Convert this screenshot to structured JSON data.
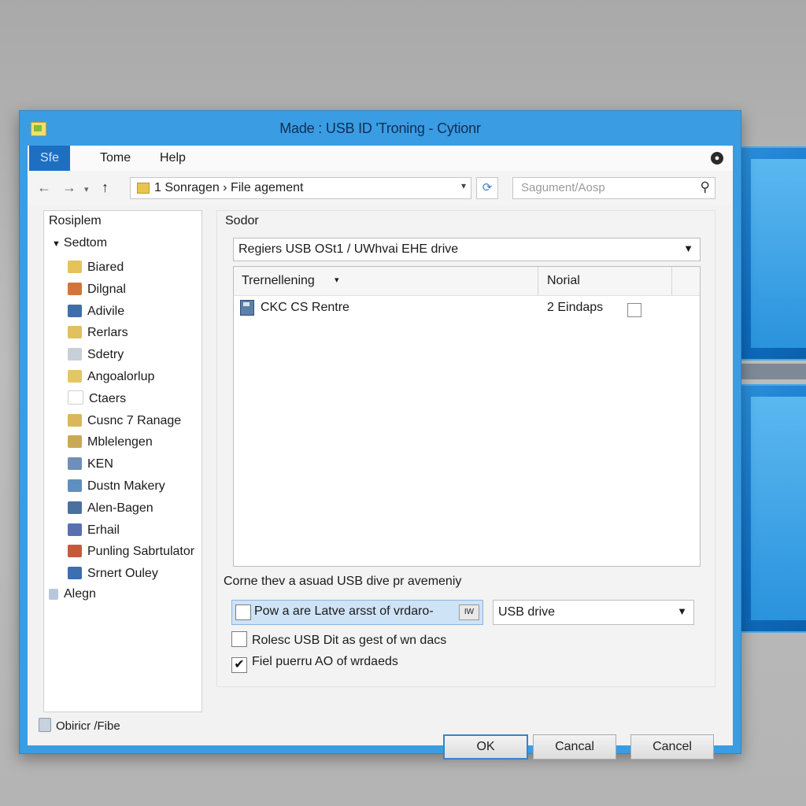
{
  "window": {
    "title": "Made : USB ID 'Troning - Cytionr"
  },
  "menu": {
    "items": [
      {
        "label": "Sfe"
      },
      {
        "label": "Tome"
      },
      {
        "label": "Help"
      }
    ]
  },
  "navigation": {
    "back_icon": "back-arrow-icon",
    "forward_icon": "forward-arrow-icon",
    "up_icon": "up-arrow-icon",
    "address_path": "1  Sonragen  ›  File agement",
    "search_placeholder": "Sagument/Aosp"
  },
  "tree": {
    "root_label": "Rosiplem",
    "section_label": "Sedtom",
    "items": [
      {
        "label": "Biared",
        "icon": "folder-icon",
        "color": "#e6c25a"
      },
      {
        "label": "Dilgnal",
        "icon": "globe-icon",
        "color": "#d4743a"
      },
      {
        "label": "Adivile",
        "icon": "drive-icon",
        "color": "#3f6ea8"
      },
      {
        "label": "Rerlars",
        "icon": "folder-icon",
        "color": "#e0c060"
      },
      {
        "label": "Sdetry",
        "icon": "document-icon",
        "color": "#c7cfd9"
      },
      {
        "label": "Angoalorlup",
        "icon": "folder-icon",
        "color": "#e3c765"
      },
      {
        "label": "Ctaers",
        "icon": "blank-icon",
        "color": "#ffffff"
      },
      {
        "label": "Cusnc 7 Ranage",
        "icon": "folder-icon",
        "color": "#d9b75a"
      },
      {
        "label": "Mblelengen",
        "icon": "folder-icon",
        "color": "#c9a955"
      },
      {
        "label": "KEN",
        "icon": "x-icon",
        "color": "#6f8fb8"
      },
      {
        "label": "Dustn Makery",
        "icon": "network-icon",
        "color": "#5f8fc0"
      },
      {
        "label": "Alen-Bagen",
        "icon": "monitor-icon",
        "color": "#4b6f9f"
      },
      {
        "label": "Erhail",
        "icon": "image-icon",
        "color": "#5a6fb2"
      },
      {
        "label": "Punling Sabrtulator",
        "icon": "app-icon",
        "color": "#c45a3c"
      },
      {
        "label": "Srnert Ouley",
        "icon": "edit-icon",
        "color": "#3a6fb0"
      }
    ],
    "extra_label": "Alegn"
  },
  "status": {
    "text": "Obiricr /Fibe"
  },
  "panel": {
    "section_label": "Sodor",
    "drive_select_value": "Regiers USB OSt1 / UWhvai EHE drive",
    "columns": [
      "Trernellening",
      "Norial"
    ],
    "rows": [
      {
        "name": "CKC CS Rentre",
        "size": "2 Eindaps"
      }
    ],
    "options_prompt": "Corne thev a asuad USB dive pr avemeniy",
    "option1_label": "Pow a are Latve arsst of vrdaro-",
    "option1_mini": "IW",
    "usb_select_value": "USB drive",
    "option2_label": "Rolesc USB Dit as gest of wn dacs",
    "option3_label": "Fiel puerru AO of wrdaeds"
  },
  "buttons": {
    "ok": "OK",
    "cancel1": "Cancal",
    "cancel2": "Cancel"
  }
}
